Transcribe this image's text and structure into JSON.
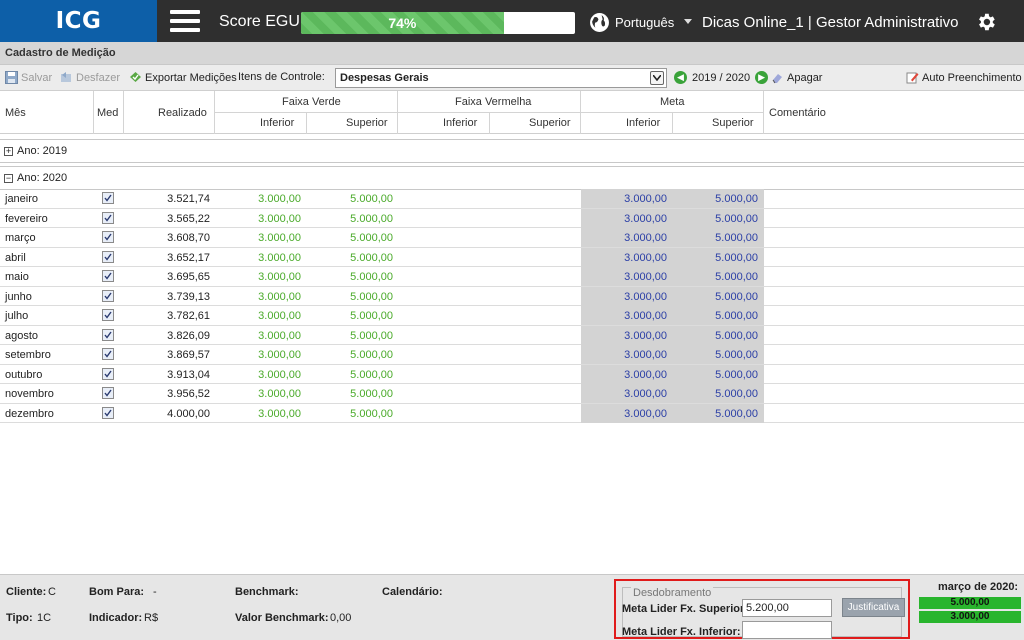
{
  "header": {
    "logo": "ICG",
    "score_label": "Score EGU:",
    "score_value": "74%",
    "score_fraction": 0.74,
    "language": "Português",
    "user": "Dicas Online_1  |  Gestor Administrativo"
  },
  "section_title": "Cadastro de Medição",
  "toolbar": {
    "save": "Salvar",
    "undo": "Desfazer",
    "export": "Exportar Medições",
    "items_label": "Itens de Controle:",
    "selected_item": "Despesas Gerais",
    "period": "2019 / 2020",
    "clear": "Apagar",
    "auto_fill": "Auto Preenchimento"
  },
  "columns": {
    "mes": "Mês",
    "med": "Med",
    "realizado": "Realizado",
    "faixa_verde": "Faixa Verde",
    "faixa_vermelha": "Faixa Vermelha",
    "meta": "Meta",
    "inferior": "Inferior",
    "superior": "Superior",
    "comentario": "Comentário"
  },
  "groups": {
    "y2019": "Ano: 2019",
    "y2020": "Ano: 2020"
  },
  "rows": [
    {
      "mes": "janeiro",
      "realizado": "3.521,74",
      "vi": "3.000,00",
      "vs": "5.000,00",
      "mi": "3.000,00",
      "ms": "5.000,00"
    },
    {
      "mes": "fevereiro",
      "realizado": "3.565,22",
      "vi": "3.000,00",
      "vs": "5.000,00",
      "mi": "3.000,00",
      "ms": "5.000,00"
    },
    {
      "mes": "março",
      "realizado": "3.608,70",
      "vi": "3.000,00",
      "vs": "5.000,00",
      "mi": "3.000,00",
      "ms": "5.000,00"
    },
    {
      "mes": "abril",
      "realizado": "3.652,17",
      "vi": "3.000,00",
      "vs": "5.000,00",
      "mi": "3.000,00",
      "ms": "5.000,00"
    },
    {
      "mes": "maio",
      "realizado": "3.695,65",
      "vi": "3.000,00",
      "vs": "5.000,00",
      "mi": "3.000,00",
      "ms": "5.000,00"
    },
    {
      "mes": "junho",
      "realizado": "3.739,13",
      "vi": "3.000,00",
      "vs": "5.000,00",
      "mi": "3.000,00",
      "ms": "5.000,00"
    },
    {
      "mes": "julho",
      "realizado": "3.782,61",
      "vi": "3.000,00",
      "vs": "5.000,00",
      "mi": "3.000,00",
      "ms": "5.000,00"
    },
    {
      "mes": "agosto",
      "realizado": "3.826,09",
      "vi": "3.000,00",
      "vs": "5.000,00",
      "mi": "3.000,00",
      "ms": "5.000,00"
    },
    {
      "mes": "setembro",
      "realizado": "3.869,57",
      "vi": "3.000,00",
      "vs": "5.000,00",
      "mi": "3.000,00",
      "ms": "5.000,00"
    },
    {
      "mes": "outubro",
      "realizado": "3.913,04",
      "vi": "3.000,00",
      "vs": "5.000,00",
      "mi": "3.000,00",
      "ms": "5.000,00"
    },
    {
      "mes": "novembro",
      "realizado": "3.956,52",
      "vi": "3.000,00",
      "vs": "5.000,00",
      "mi": "3.000,00",
      "ms": "5.000,00"
    },
    {
      "mes": "dezembro",
      "realizado": "4.000,00",
      "vi": "3.000,00",
      "vs": "5.000,00",
      "mi": "3.000,00",
      "ms": "5.000,00"
    }
  ],
  "footer": {
    "cliente_label": "Cliente:",
    "cliente_value": "C",
    "tipo_label": "Tipo:",
    "tipo_value": "1C",
    "bom_para_label": "Bom Para:",
    "bom_para_value": "-",
    "indicador_label": "Indicador:",
    "indicador_value": "R$",
    "benchmark_label": "Benchmark:",
    "valor_benchmark_label": "Valor Benchmark:",
    "valor_benchmark_value": "0,00",
    "calendario_label": "Calendário:",
    "desdobramento_legend": "Desdobramento",
    "meta_sup_label": "Meta Lider Fx. Superior:",
    "meta_sup_value": "5.200,00",
    "meta_inf_label": "Meta Lider Fx. Inferior:",
    "meta_inf_value": "",
    "justificativa": "Justificativa",
    "month_title": "março de 2020:",
    "month_val1": "5.000,00",
    "month_val2": "3.000,00"
  },
  "colors": {
    "logo_bg": "#0d5fa8",
    "topbar_bg": "#2f2f2f",
    "green_text": "#4aaa2a",
    "blue_text": "#2b3fa6",
    "highlight_border": "#e01b1b",
    "progress_green": "#5cb85c"
  }
}
